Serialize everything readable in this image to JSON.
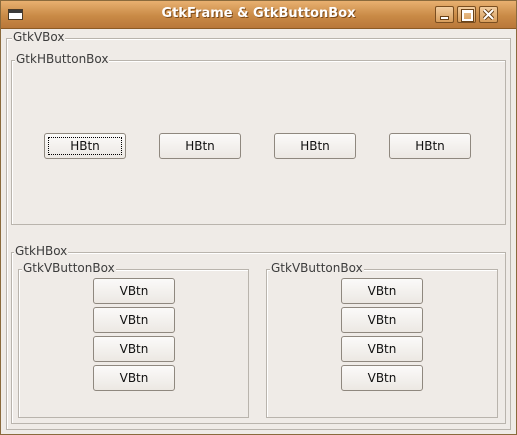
{
  "window": {
    "title": "GtkFrame & GtkButtonBox"
  },
  "vbox": {
    "label": "GtkVBox"
  },
  "hbuttonbox": {
    "label": "GtkHButtonBox",
    "buttons": [
      "HBtn",
      "HBtn",
      "HBtn",
      "HBtn"
    ]
  },
  "hbox": {
    "label": "GtkHBox"
  },
  "vbuttonboxes": [
    {
      "label": "GtkVButtonBox",
      "buttons": [
        "VBtn",
        "VBtn",
        "VBtn",
        "VBtn"
      ]
    },
    {
      "label": "GtkVButtonBox",
      "buttons": [
        "VBtn",
        "VBtn",
        "VBtn",
        "VBtn"
      ]
    }
  ]
}
